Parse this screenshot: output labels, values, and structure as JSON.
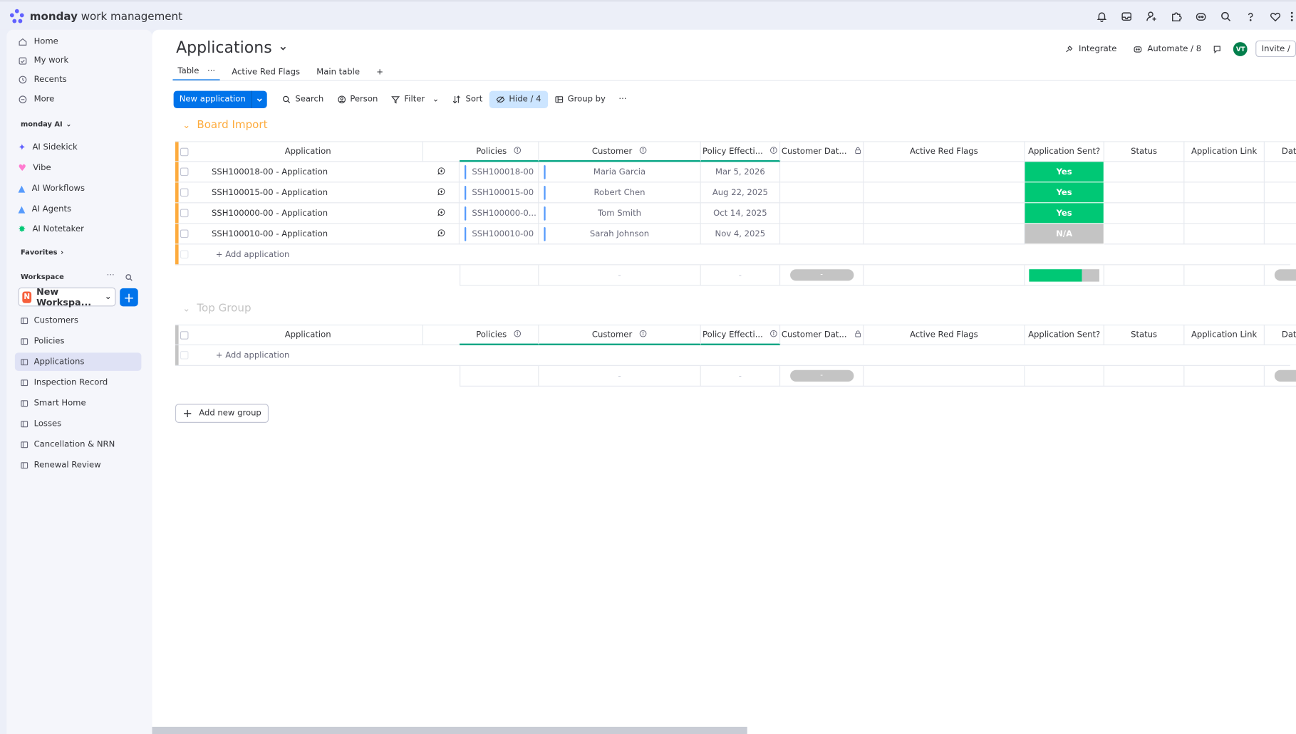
{
  "app": {
    "brand_bold": "monday",
    "brand_rest": " work management"
  },
  "sidebar": {
    "nav": [
      "Home",
      "My work",
      "Recents",
      "More"
    ],
    "ai_label": "monday AI",
    "ai_items": [
      "AI Sidekick",
      "Vibe",
      "AI Workflows",
      "AI Agents",
      "AI Notetaker"
    ],
    "favorites_label": "Favorites",
    "workspace_label": "Workspace",
    "workspace_badge": "N",
    "workspace_name": "New Workspa...",
    "boards": [
      "Customers",
      "Policies",
      "Applications",
      "Inspection Record",
      "Smart Home",
      "Losses",
      "Cancellation & NRN",
      "Renewal Review"
    ],
    "active_board": "Applications"
  },
  "header": {
    "title": "Applications",
    "integrate": "Integrate",
    "automate": "Automate / 8",
    "avatar": "VT",
    "invite": "Invite /",
    "tabs": [
      "Table",
      "Active Red Flags",
      "Main table"
    ],
    "add_tab": "+"
  },
  "toolbar": {
    "new_button": "New application",
    "search": "Search",
    "person": "Person",
    "filter": "Filter",
    "sort": "Sort",
    "hide": "Hide / 4",
    "group_by": "Group by",
    "more": "···"
  },
  "columns": [
    "Application",
    "Policies",
    "Customer",
    "Policy Effecti...",
    "Customer Dat...",
    "Active Red Flags",
    "Application Sent?",
    "Status",
    "Application Link",
    "Dat"
  ],
  "groups": [
    {
      "name": "Board Import",
      "color": "#fdab3d",
      "rows": [
        {
          "name": "SSH100018-00 - Application",
          "policy": "SSH100018-00",
          "customer": "Maria Garcia",
          "effective": "Mar 5, 2026",
          "sent": "Yes",
          "sent_color": "#00c875"
        },
        {
          "name": "SSH100015-00 - Application",
          "policy": "SSH100015-00",
          "customer": "Robert Chen",
          "effective": "Aug 22, 2025",
          "sent": "Yes",
          "sent_color": "#00c875"
        },
        {
          "name": "SSH100000-00 - Application",
          "policy": "SSH100000-0...",
          "customer": "Tom Smith",
          "effective": "Oct 14, 2025",
          "sent": "Yes",
          "sent_color": "#00c875"
        },
        {
          "name": "SSH100010-00 - Application",
          "policy": "SSH100010-00",
          "customer": "Sarah Johnson",
          "effective": "Nov 4, 2025",
          "sent": "N/A",
          "sent_color": "#c4c4c4"
        }
      ],
      "add_label": "+ Add application",
      "summary_customer": "-",
      "summary_effective": "-",
      "summary_pill": "-",
      "sent_progress": 0.75
    },
    {
      "name": "Top Group",
      "color": "#c4c4c4",
      "rows": [],
      "add_label": "+ Add application",
      "summary_customer": "-",
      "summary_effective": "-",
      "summary_pill": "-"
    }
  ],
  "add_group": "Add new group"
}
